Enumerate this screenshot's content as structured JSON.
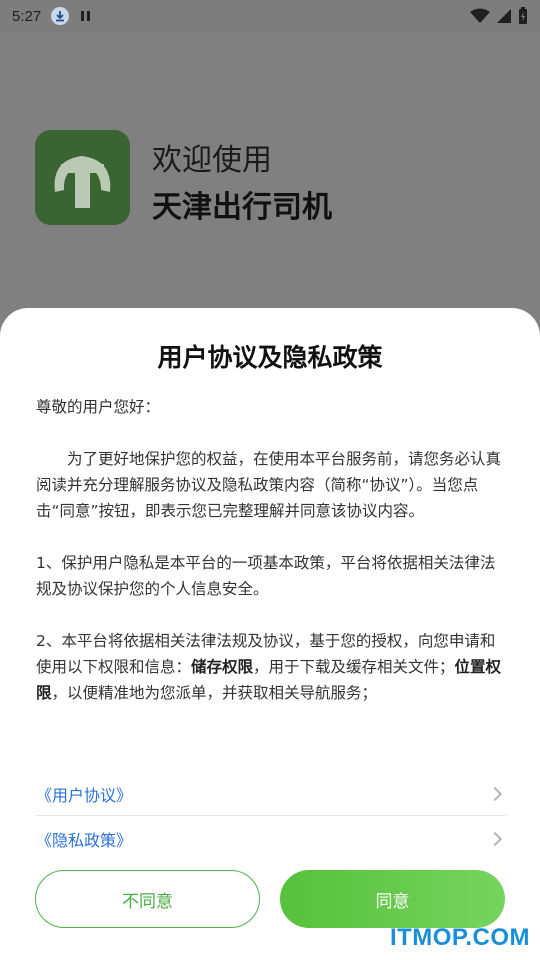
{
  "status_bar": {
    "time": "5:27",
    "icons": [
      "download-icon",
      "pause-icon",
      "wifi-icon",
      "signal-icon",
      "battery-icon"
    ]
  },
  "splash": {
    "welcome": "欢迎使用",
    "app_name": "天津出行司机"
  },
  "dialog": {
    "title": "用户协议及隐私政策",
    "greeting": "尊敬的用户您好：",
    "para1": "为了更好地保护您的权益，在使用本平台服务前，请您务必认真阅读并充分理解服务协议及隐私政策内容（简称“协议”）。当您点击“同意”按钮，即表示您已完整理解并同意该协议内容。",
    "para2": "1、保护用户隐私是本平台的一项基本政策，平台将依据相关法律法规及协议保护您的个人信息安全。",
    "para3_a": "2、本平台将依据相关法律法规及协议，基于您的授权，向您申请和使用以下权限和信息：",
    "para3_b": "储存权限",
    "para3_c": "，用于下载及缓存相关文件；",
    "para3_d": "位置权限",
    "para3_e": "，以便精准地为您派单，并获取相关导航服务；",
    "link_user_agreement": "《用户协议》",
    "link_privacy_policy": "《隐私政策》",
    "disagree_label": "不同意",
    "agree_label": "同意"
  },
  "watermark": "ITMOP.COM",
  "colors": {
    "accent_green": "#4db34a",
    "link_blue": "#2a72d4",
    "logo_green": "#37602f",
    "overlay_gray": "#808080"
  }
}
